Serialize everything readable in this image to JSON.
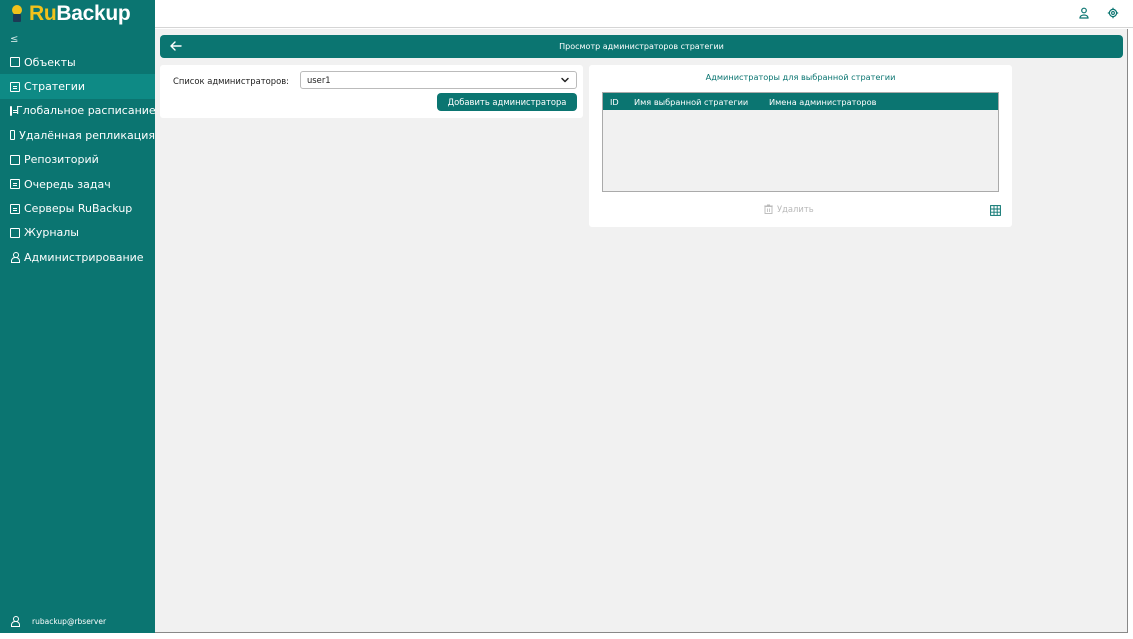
{
  "app": {
    "logo_ru": "Ru",
    "logo_backup": "Backup",
    "collapse_icon": "≤"
  },
  "colors": {
    "brand": "#0b7571",
    "brand_active": "#0e8a85",
    "logo_accent": "#f2c21b",
    "disabled_text": "#b9b9b9"
  },
  "sidebar": {
    "items": [
      {
        "label": "Объекты",
        "icon": "monitor-icon"
      },
      {
        "label": "Стратегии",
        "icon": "document-icon",
        "active": true
      },
      {
        "label": "Глобальное расписание",
        "icon": "document-icon"
      },
      {
        "label": "Удалённая репликация",
        "icon": "replication-icon"
      },
      {
        "label": "Репозиторий",
        "icon": "storage-icon"
      },
      {
        "label": "Очередь задач",
        "icon": "clipboard-icon"
      },
      {
        "label": "Серверы RuBackup",
        "icon": "server-icon"
      },
      {
        "label": "Журналы",
        "icon": "log-icon"
      },
      {
        "label": "Администрирование",
        "icon": "users-icon"
      }
    ],
    "footer_user": "rubackup@rbserver"
  },
  "header": {
    "title": "Просмотр администраторов стратегии"
  },
  "form": {
    "label": "Список администраторов:",
    "selected_admin": "user1",
    "add_button": "Добавить администратора"
  },
  "admins_panel": {
    "title": "Администраторы для выбранной стратегии",
    "columns": [
      "ID",
      "Имя выбранной стратегии",
      "Имена администраторов"
    ],
    "rows": [],
    "delete_button": "Удалить"
  }
}
